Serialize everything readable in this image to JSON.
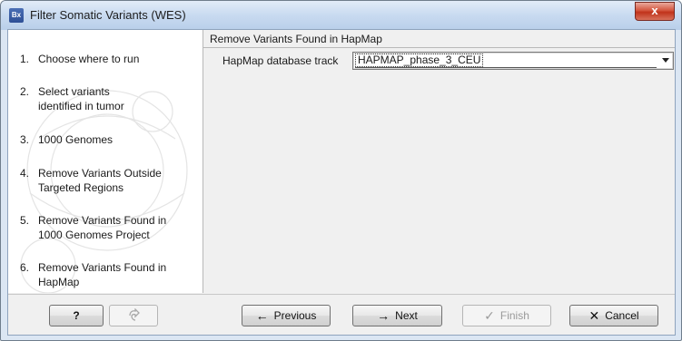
{
  "window": {
    "app_icon_text": "Bx",
    "title": "Filter Somatic Variants (WES)",
    "close_glyph": "x"
  },
  "sidebar": {
    "steps": [
      {
        "num": "1.",
        "label": "Choose where to run"
      },
      {
        "num": "2.",
        "label": "Select variants identified in tumor"
      },
      {
        "num": "3.",
        "label": "1000 Genomes"
      },
      {
        "num": "4.",
        "label": "Remove Variants Outside Targeted Regions"
      },
      {
        "num": "5.",
        "label": "Remove Variants Found in 1000 Genomes Project"
      },
      {
        "num": "6.",
        "label": "Remove Variants Found in HapMap"
      }
    ],
    "active_step": 6
  },
  "main": {
    "section_title": "Remove Variants Found in HapMap",
    "hapmap_label": "HapMap database track",
    "hapmap_value": "HAPMAP_phase_3_CEU"
  },
  "footer": {
    "help_label": "?",
    "reset_icon": "reset-icon",
    "previous_label": "Previous",
    "next_label": "Next",
    "finish_label": "Finish",
    "cancel_label": "Cancel"
  }
}
